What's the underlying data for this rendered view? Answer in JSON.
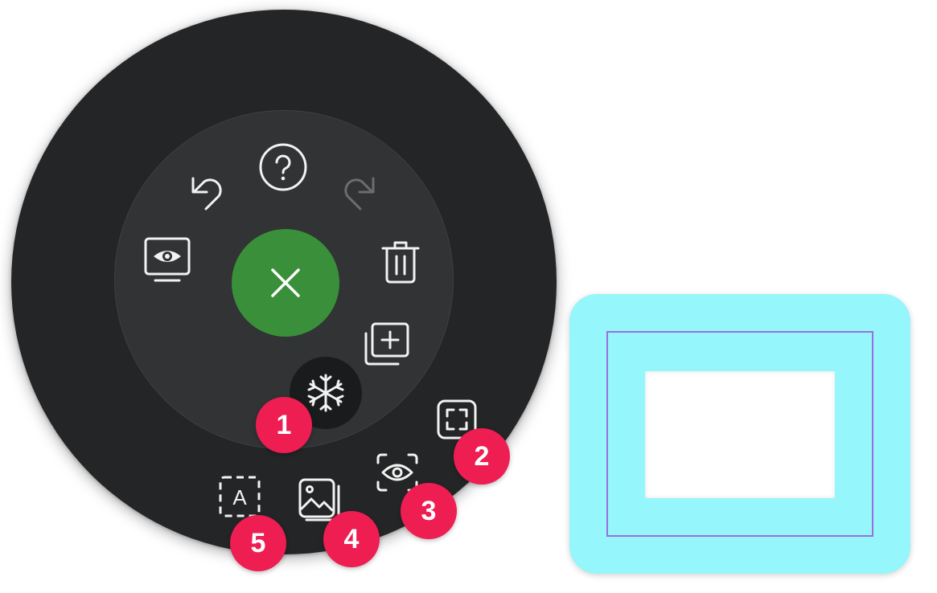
{
  "menu": {
    "buttons": [
      {
        "name": "help-button",
        "icon": "question-circle-icon"
      },
      {
        "name": "undo-button",
        "icon": "undo-arrow-icon"
      },
      {
        "name": "redo-button",
        "icon": "redo-arrow-icon",
        "disabled": true
      },
      {
        "name": "display-button",
        "icon": "eye-monitor-icon"
      },
      {
        "name": "delete-button",
        "icon": "trash-icon"
      },
      {
        "name": "new-page-button",
        "icon": "add-layer-icon"
      },
      {
        "name": "close-button",
        "icon": "close-icon"
      },
      {
        "name": "freeze-button",
        "icon": "snowflake-icon"
      },
      {
        "name": "screenshot-button",
        "icon": "dashed-frame-icon"
      },
      {
        "name": "screen-view-button",
        "icon": "scan-eye-icon"
      },
      {
        "name": "image-button",
        "icon": "image-stack-icon"
      },
      {
        "name": "text-button",
        "icon": "text-box-icon"
      }
    ],
    "colors": {
      "outer_ring": "#242526",
      "inner_ring": "#313335",
      "close_button": "#3a8f3a",
      "icon_stroke": "#f2f2f2",
      "disabled_icon": "#6b6d70"
    }
  },
  "badges": [
    "1",
    "2",
    "3",
    "4",
    "5"
  ],
  "badge_color": "#ee1d52",
  "text_box_letter": "A",
  "selection": {
    "frame_color": "#95f6fb",
    "outline_color": "#9a6fe0"
  }
}
